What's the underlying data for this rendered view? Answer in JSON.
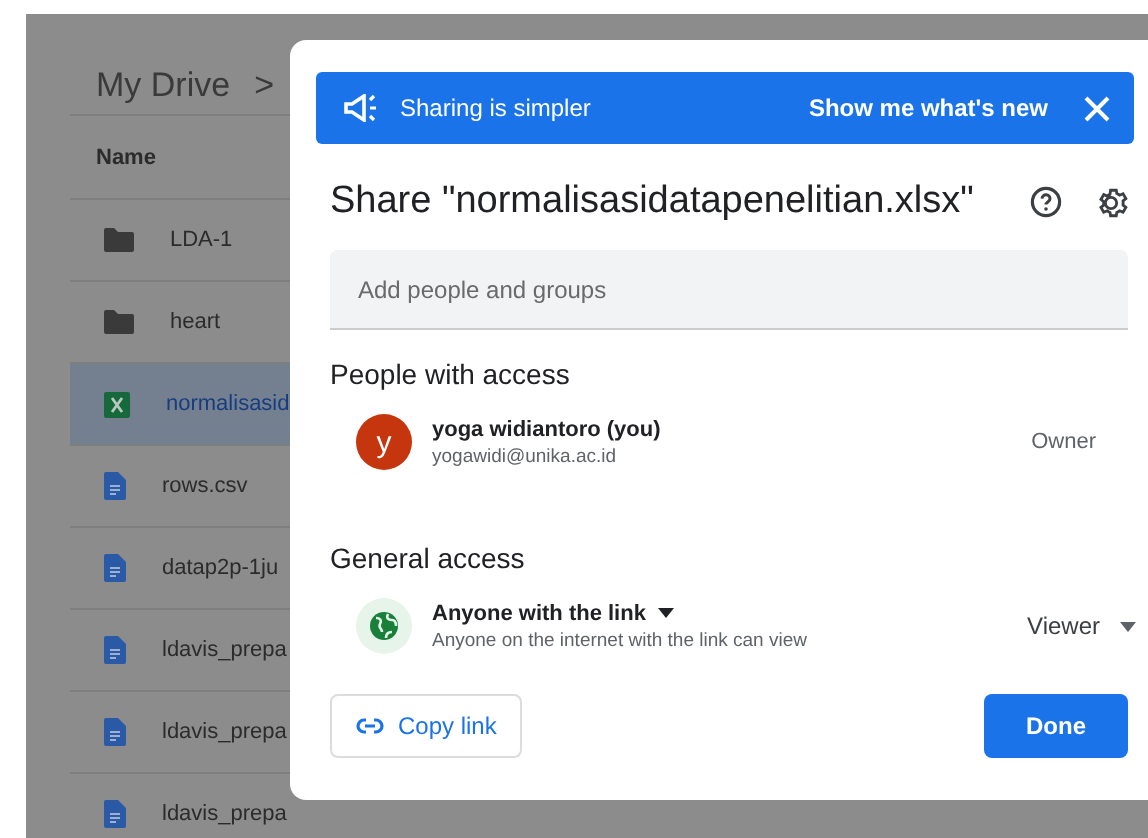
{
  "drive": {
    "breadcrumb": "My Drive",
    "breadcrumb_arrow": ">",
    "column_header": "Name",
    "files": [
      {
        "name": "LDA-1",
        "kind": "folder",
        "selected": false
      },
      {
        "name": "heart",
        "kind": "folder",
        "selected": false
      },
      {
        "name": "normalisasid",
        "kind": "sheet",
        "selected": true
      },
      {
        "name": "rows.csv",
        "kind": "doc",
        "selected": false
      },
      {
        "name": "datap2p-1ju",
        "kind": "doc",
        "selected": false
      },
      {
        "name": "ldavis_prepa",
        "kind": "doc",
        "selected": false
      },
      {
        "name": "ldavis_prepa",
        "kind": "doc",
        "selected": false
      },
      {
        "name": "ldavis_prepa",
        "kind": "doc",
        "selected": false
      }
    ]
  },
  "dialog": {
    "banner": {
      "text": "Sharing is simpler",
      "link": "Show me what's new"
    },
    "title": "Share \"normalisasidatapenelitian.xlsx\"",
    "search": {
      "placeholder": "Add people and groups"
    },
    "people_heading": "People with access",
    "people": [
      {
        "initial": "y",
        "name": "yoga widiantoro (you)",
        "email": "yogawidi@unika.ac.id",
        "role": "Owner",
        "color": "#c5360f"
      }
    ],
    "general_heading": "General access",
    "access": {
      "label": "Anyone with the link",
      "description": "Anyone on the internet with the link can view",
      "role": "Viewer"
    },
    "copy_link": "Copy link",
    "done": "Done"
  }
}
